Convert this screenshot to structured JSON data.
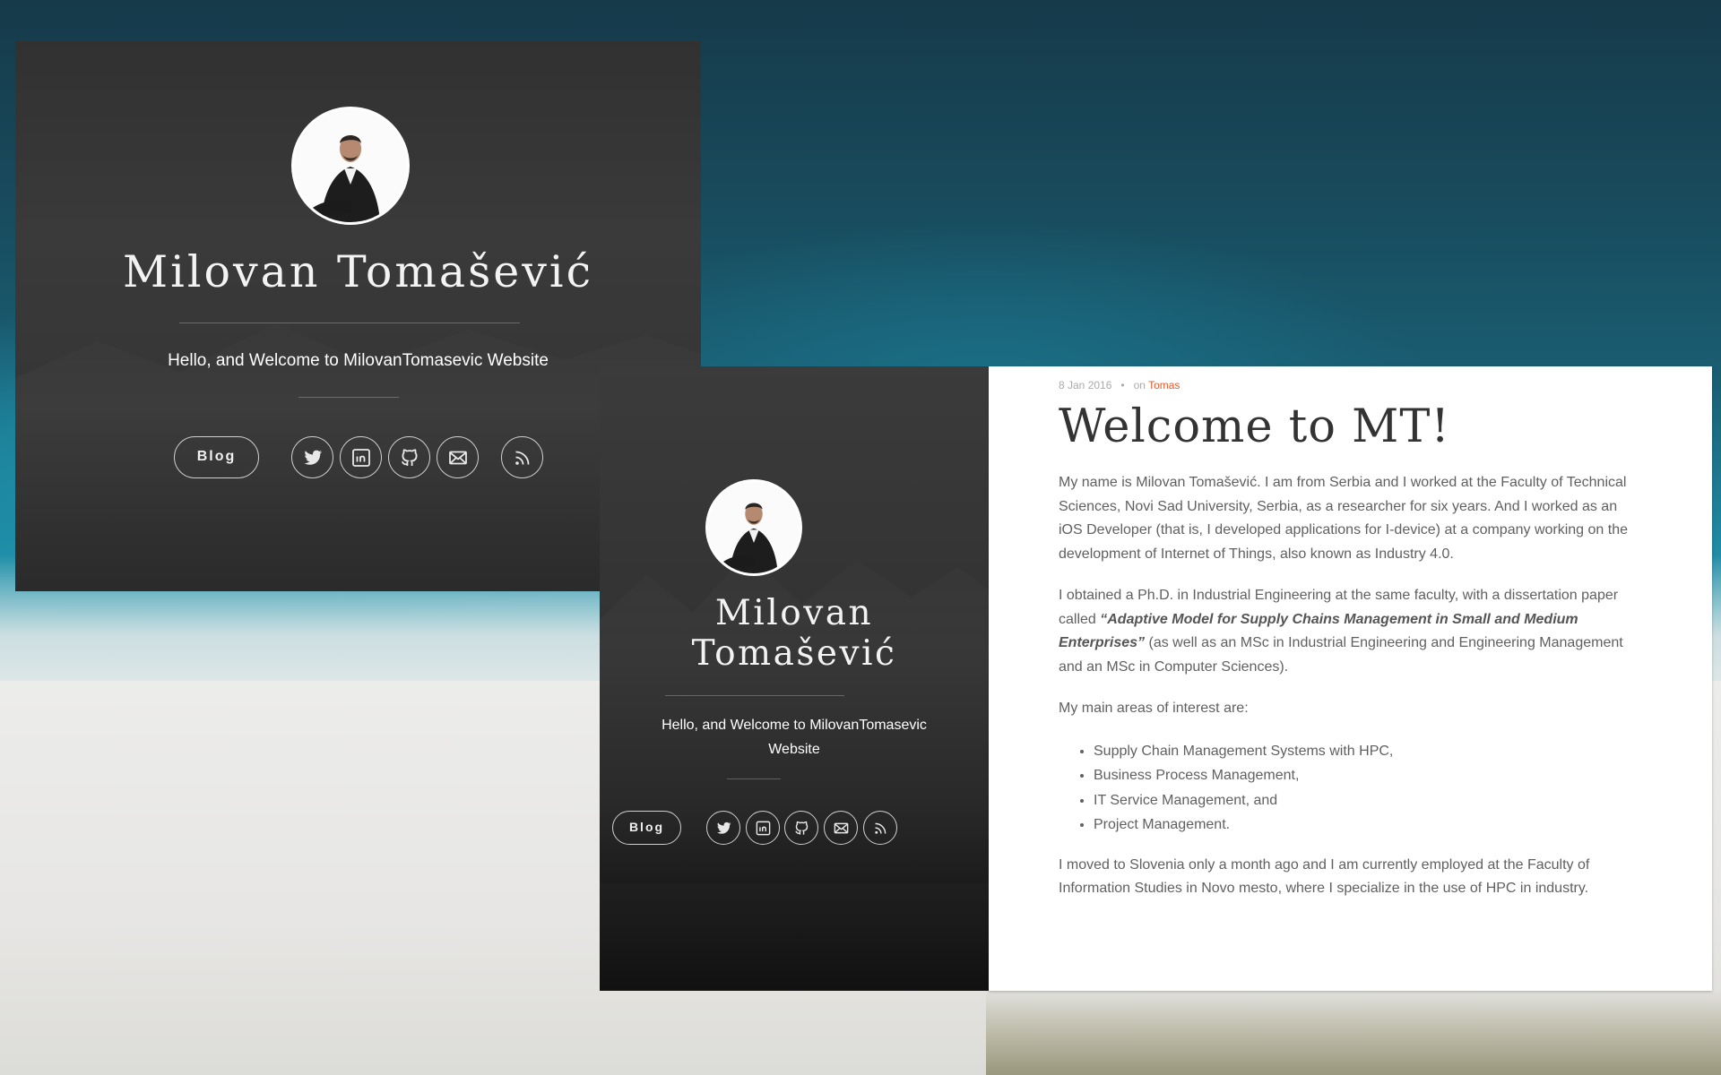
{
  "profile": {
    "name": "Milovan Tomašević",
    "name_line1": "Milovan",
    "name_line2": "Tomašević",
    "tagline": "Hello, and Welcome to MilovanTomasevic Website",
    "tagline_line1": "Hello, and Welcome to MilovanTomasevic",
    "tagline_line2": "Website",
    "blog_button": "Blog",
    "social_icons": [
      "twitter-icon",
      "linkedin-icon",
      "github-icon",
      "email-icon",
      "rss-icon"
    ]
  },
  "post": {
    "date": "8 Jan 2016",
    "separator": "•",
    "on_label": "on",
    "author": "Tomas",
    "title": "Welcome to MT!",
    "p1": "My name is Milovan Tomašević. I am from Serbia and I worked at the Faculty of Technical Sciences, Novi Sad University, Serbia, as a researcher for six years. And I worked as an iOS Developer (that is, I developed applications for I-device) at a company working on the development of Internet of Things, also known as Industry 4.0.",
    "p2_before": "I obtained a Ph.D. in Industrial Engineering at the same faculty, with a dissertation paper called ",
    "p2_emphasis": "“Adaptive Model for Supply Chains Management in Small and Medium Enterprises”",
    "p2_after": " (as well as an MSc in Industrial Engineering and Engineering Management and an MSc in Computer Sciences).",
    "p3": "My main areas of interest are:",
    "interests": [
      "Supply Chain Management Systems with HPC,",
      "Business Process Management,",
      "IT Service Management, and",
      "Project Management."
    ],
    "p4": "I moved to Slovenia only a month ago and I am currently employed at the Faculty of Information Studies in Novo mesto, where I specialize in the use of HPC in industry."
  },
  "colors": {
    "accent": "#e2592a",
    "card_dark": "#353535",
    "ocean": "#1a5d72"
  }
}
